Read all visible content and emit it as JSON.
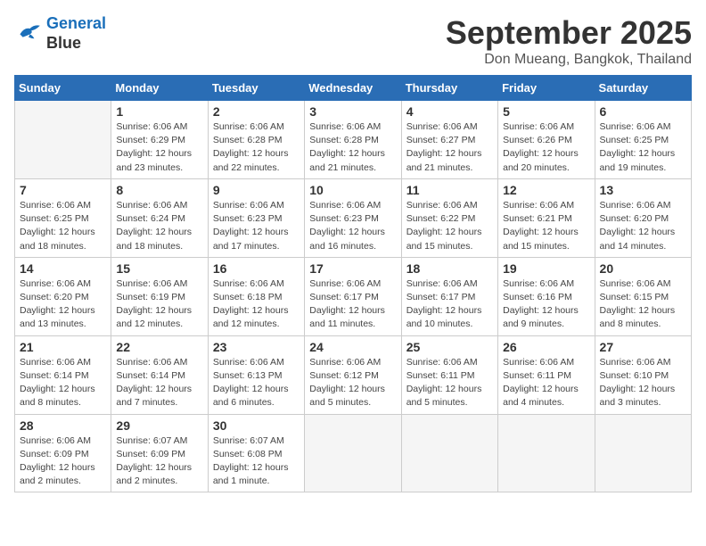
{
  "logo": {
    "line1": "General",
    "line2": "Blue"
  },
  "title": "September 2025",
  "subtitle": "Don Mueang, Bangkok, Thailand",
  "days_of_week": [
    "Sunday",
    "Monday",
    "Tuesday",
    "Wednesday",
    "Thursday",
    "Friday",
    "Saturday"
  ],
  "weeks": [
    [
      {
        "day": "",
        "detail": ""
      },
      {
        "day": "1",
        "detail": "Sunrise: 6:06 AM\nSunset: 6:29 PM\nDaylight: 12 hours\nand 23 minutes."
      },
      {
        "day": "2",
        "detail": "Sunrise: 6:06 AM\nSunset: 6:28 PM\nDaylight: 12 hours\nand 22 minutes."
      },
      {
        "day": "3",
        "detail": "Sunrise: 6:06 AM\nSunset: 6:28 PM\nDaylight: 12 hours\nand 21 minutes."
      },
      {
        "day": "4",
        "detail": "Sunrise: 6:06 AM\nSunset: 6:27 PM\nDaylight: 12 hours\nand 21 minutes."
      },
      {
        "day": "5",
        "detail": "Sunrise: 6:06 AM\nSunset: 6:26 PM\nDaylight: 12 hours\nand 20 minutes."
      },
      {
        "day": "6",
        "detail": "Sunrise: 6:06 AM\nSunset: 6:25 PM\nDaylight: 12 hours\nand 19 minutes."
      }
    ],
    [
      {
        "day": "7",
        "detail": "Sunrise: 6:06 AM\nSunset: 6:25 PM\nDaylight: 12 hours\nand 18 minutes."
      },
      {
        "day": "8",
        "detail": "Sunrise: 6:06 AM\nSunset: 6:24 PM\nDaylight: 12 hours\nand 18 minutes."
      },
      {
        "day": "9",
        "detail": "Sunrise: 6:06 AM\nSunset: 6:23 PM\nDaylight: 12 hours\nand 17 minutes."
      },
      {
        "day": "10",
        "detail": "Sunrise: 6:06 AM\nSunset: 6:23 PM\nDaylight: 12 hours\nand 16 minutes."
      },
      {
        "day": "11",
        "detail": "Sunrise: 6:06 AM\nSunset: 6:22 PM\nDaylight: 12 hours\nand 15 minutes."
      },
      {
        "day": "12",
        "detail": "Sunrise: 6:06 AM\nSunset: 6:21 PM\nDaylight: 12 hours\nand 15 minutes."
      },
      {
        "day": "13",
        "detail": "Sunrise: 6:06 AM\nSunset: 6:20 PM\nDaylight: 12 hours\nand 14 minutes."
      }
    ],
    [
      {
        "day": "14",
        "detail": "Sunrise: 6:06 AM\nSunset: 6:20 PM\nDaylight: 12 hours\nand 13 minutes."
      },
      {
        "day": "15",
        "detail": "Sunrise: 6:06 AM\nSunset: 6:19 PM\nDaylight: 12 hours\nand 12 minutes."
      },
      {
        "day": "16",
        "detail": "Sunrise: 6:06 AM\nSunset: 6:18 PM\nDaylight: 12 hours\nand 12 minutes."
      },
      {
        "day": "17",
        "detail": "Sunrise: 6:06 AM\nSunset: 6:17 PM\nDaylight: 12 hours\nand 11 minutes."
      },
      {
        "day": "18",
        "detail": "Sunrise: 6:06 AM\nSunset: 6:17 PM\nDaylight: 12 hours\nand 10 minutes."
      },
      {
        "day": "19",
        "detail": "Sunrise: 6:06 AM\nSunset: 6:16 PM\nDaylight: 12 hours\nand 9 minutes."
      },
      {
        "day": "20",
        "detail": "Sunrise: 6:06 AM\nSunset: 6:15 PM\nDaylight: 12 hours\nand 8 minutes."
      }
    ],
    [
      {
        "day": "21",
        "detail": "Sunrise: 6:06 AM\nSunset: 6:14 PM\nDaylight: 12 hours\nand 8 minutes."
      },
      {
        "day": "22",
        "detail": "Sunrise: 6:06 AM\nSunset: 6:14 PM\nDaylight: 12 hours\nand 7 minutes."
      },
      {
        "day": "23",
        "detail": "Sunrise: 6:06 AM\nSunset: 6:13 PM\nDaylight: 12 hours\nand 6 minutes."
      },
      {
        "day": "24",
        "detail": "Sunrise: 6:06 AM\nSunset: 6:12 PM\nDaylight: 12 hours\nand 5 minutes."
      },
      {
        "day": "25",
        "detail": "Sunrise: 6:06 AM\nSunset: 6:11 PM\nDaylight: 12 hours\nand 5 minutes."
      },
      {
        "day": "26",
        "detail": "Sunrise: 6:06 AM\nSunset: 6:11 PM\nDaylight: 12 hours\nand 4 minutes."
      },
      {
        "day": "27",
        "detail": "Sunrise: 6:06 AM\nSunset: 6:10 PM\nDaylight: 12 hours\nand 3 minutes."
      }
    ],
    [
      {
        "day": "28",
        "detail": "Sunrise: 6:06 AM\nSunset: 6:09 PM\nDaylight: 12 hours\nand 2 minutes."
      },
      {
        "day": "29",
        "detail": "Sunrise: 6:07 AM\nSunset: 6:09 PM\nDaylight: 12 hours\nand 2 minutes."
      },
      {
        "day": "30",
        "detail": "Sunrise: 6:07 AM\nSunset: 6:08 PM\nDaylight: 12 hours\nand 1 minute."
      },
      {
        "day": "",
        "detail": ""
      },
      {
        "day": "",
        "detail": ""
      },
      {
        "day": "",
        "detail": ""
      },
      {
        "day": "",
        "detail": ""
      }
    ]
  ]
}
